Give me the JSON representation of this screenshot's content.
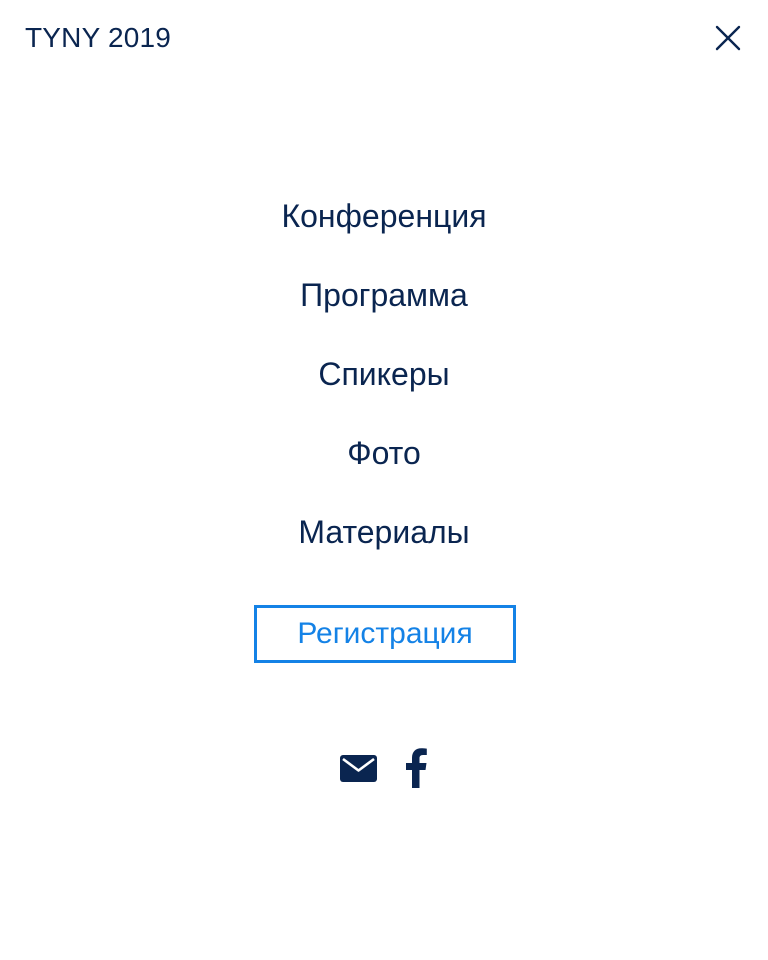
{
  "header": {
    "logo_text": "TYNY 2019",
    "close_icon": "close-icon",
    "close_label": "Закрыть"
  },
  "menu": {
    "items": [
      {
        "label": "Конференция"
      },
      {
        "label": "Программа"
      },
      {
        "label": "Спикеры"
      },
      {
        "label": "Фото"
      },
      {
        "label": "Материалы"
      }
    ],
    "register_label": "Регистрация"
  },
  "social": [
    {
      "icon": "envelope-icon",
      "label": "Email"
    },
    {
      "icon": "facebook-icon",
      "label": "Facebook"
    }
  ],
  "colors": {
    "text": "#0a2550",
    "accent": "#1482e6",
    "background": "#ffffff"
  }
}
